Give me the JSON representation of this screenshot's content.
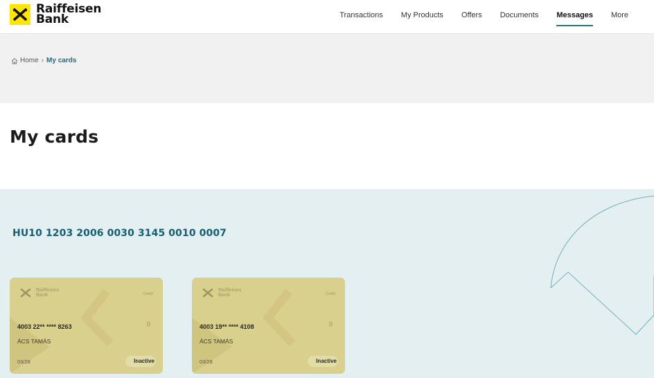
{
  "brand": {
    "line1": "Raiffeisen",
    "line2": "Bank"
  },
  "nav": {
    "items": [
      {
        "label": "Transactions"
      },
      {
        "label": "My Products"
      },
      {
        "label": "Offers"
      },
      {
        "label": "Documents"
      },
      {
        "label": "Messages",
        "active": true
      },
      {
        "label": "More"
      }
    ]
  },
  "breadcrumb": {
    "home": "Home",
    "separator": "›",
    "current": "My cards"
  },
  "page": {
    "title": "My cards"
  },
  "account": {
    "iban": "HU10 1203 2006 0030 3145 0010 0007",
    "cards": [
      {
        "brand_line1": "Raiffeisen",
        "brand_line2": "Bank",
        "type": "Debit",
        "number": "4003 22** **** 8263",
        "holder": "ÁCS TAMÁS",
        "expiry": "03/28",
        "status": "Inactive"
      },
      {
        "brand_line1": "Raiffeisen",
        "brand_line2": "Bank",
        "type": "Debit",
        "number": "4003 19** **** 4108",
        "holder": "ÁCS TAMÁS",
        "expiry": "03/28",
        "status": "Inactive"
      }
    ]
  },
  "colors": {
    "brand_yellow": "#ffe600",
    "accent_teal": "#1f6d80",
    "section_bg": "#e3eff1",
    "card_bg": "#d8d08c"
  },
  "icons": {
    "logo": "raiffeisen-cross-icon",
    "home": "home-icon",
    "contactless": "contactless-icon"
  }
}
